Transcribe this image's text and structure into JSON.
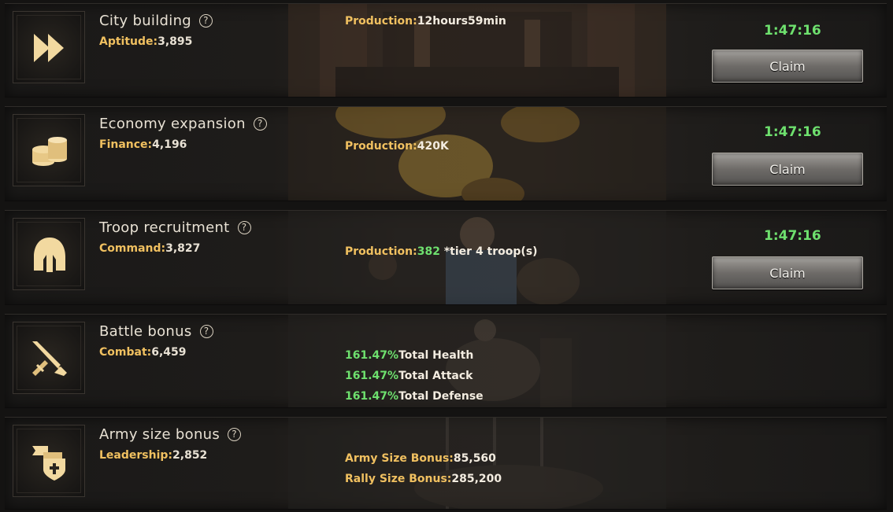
{
  "rows": [
    {
      "title": "City building",
      "stat_key": "Aptitude:",
      "stat_val": "3,895",
      "prod_key": "Production:",
      "prod_val": "12hours59min",
      "timer": "1:47:16",
      "claim": "Claim",
      "icon": "fast-forward-icon"
    },
    {
      "title": "Economy expansion",
      "stat_key": "Finance:",
      "stat_val": "4,196",
      "prod_key": "Production:",
      "prod_val": "420K",
      "timer": "1:47:16",
      "claim": "Claim",
      "icon": "coin-stack-icon"
    },
    {
      "title": "Troop recruitment",
      "stat_key": "Command:",
      "stat_val": "3,827",
      "prod_key": "Production:",
      "prod_val": "382",
      "prod_suffix": " *tier 4 troop(s)",
      "timer": "1:47:16",
      "claim": "Claim",
      "icon": "helmet-icon"
    },
    {
      "title": "Battle bonus",
      "stat_key": "Combat:",
      "stat_val": "6,459",
      "bonuses": [
        {
          "pct": "161.47%",
          "label": "Total Health"
        },
        {
          "pct": "161.47%",
          "label": "Total Attack"
        },
        {
          "pct": "161.47%",
          "label": "Total Defense"
        }
      ],
      "icon": "crossed-swords-icon"
    },
    {
      "title": "Army size bonus",
      "stat_key": "Leadership:",
      "stat_val": "2,852",
      "army_key": "Army Size Bonus:",
      "army_val": "85,560",
      "rally_key": "Rally Size Bonus:",
      "rally_val": "285,200",
      "icon": "banner-shield-icon"
    }
  ],
  "help_symbol": "?",
  "colors": {
    "accent_gold": "#f0c060",
    "timer_green": "#6ee06e",
    "icon_gold": "#f2d9a0"
  }
}
